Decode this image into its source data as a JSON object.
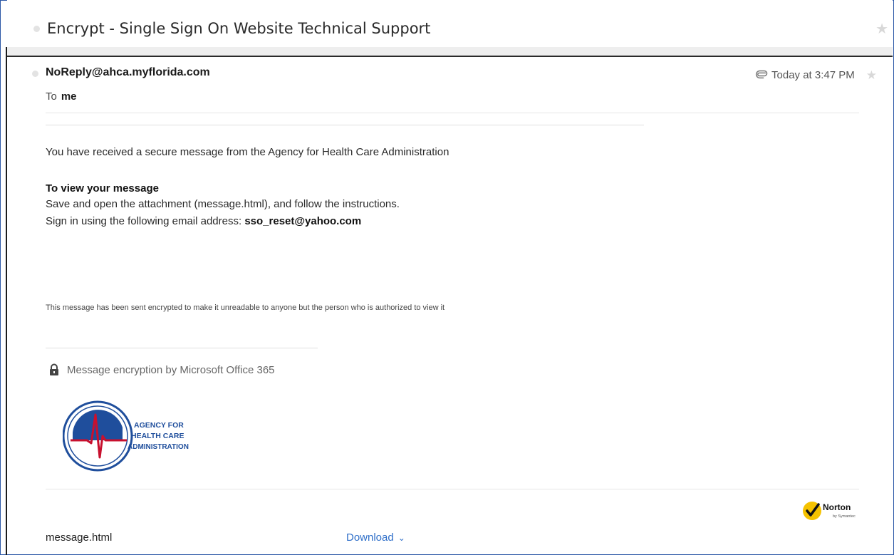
{
  "conversation": {
    "subject": "Encrypt - Single Sign On Website Technical Support"
  },
  "message": {
    "sender": "NoReply@ahca.myflorida.com",
    "to_label": "To",
    "recipient": "me",
    "timestamp": "Today at 3:47 PM",
    "has_attachment": true,
    "intro": "You have received a secure message from the Agency for Health Care Administration",
    "view_heading": "To view your message",
    "instruction_1": "Save and open the attachment (message.html), and follow the instructions.",
    "instruction_2_prefix": "Sign in using the following email address: ",
    "instruction_2_email": "sso_reset@yahoo.com",
    "notice": "This message has been sent encrypted to make it unreadable to anyone but the person who is authorized to view it",
    "encryption_label": "Message encryption by Microsoft Office 365"
  },
  "logo": {
    "line1": "AGENCY FOR",
    "line2": "HEALTH CARE",
    "line3": "ADMINISTRATION"
  },
  "norton": {
    "name": "Norton",
    "sub": "by Symantec"
  },
  "attachment": {
    "filename": "message.html",
    "download_label": "Download"
  },
  "icons": {
    "star": "star-icon",
    "paperclip": "paperclip-icon",
    "lock": "lock-icon",
    "chevron": "chevron-down-icon"
  },
  "colors": {
    "accent": "#2f6fc9",
    "logo_blue": "#1f4e9c",
    "logo_red": "#c8102e",
    "norton_yellow": "#f5c200"
  }
}
